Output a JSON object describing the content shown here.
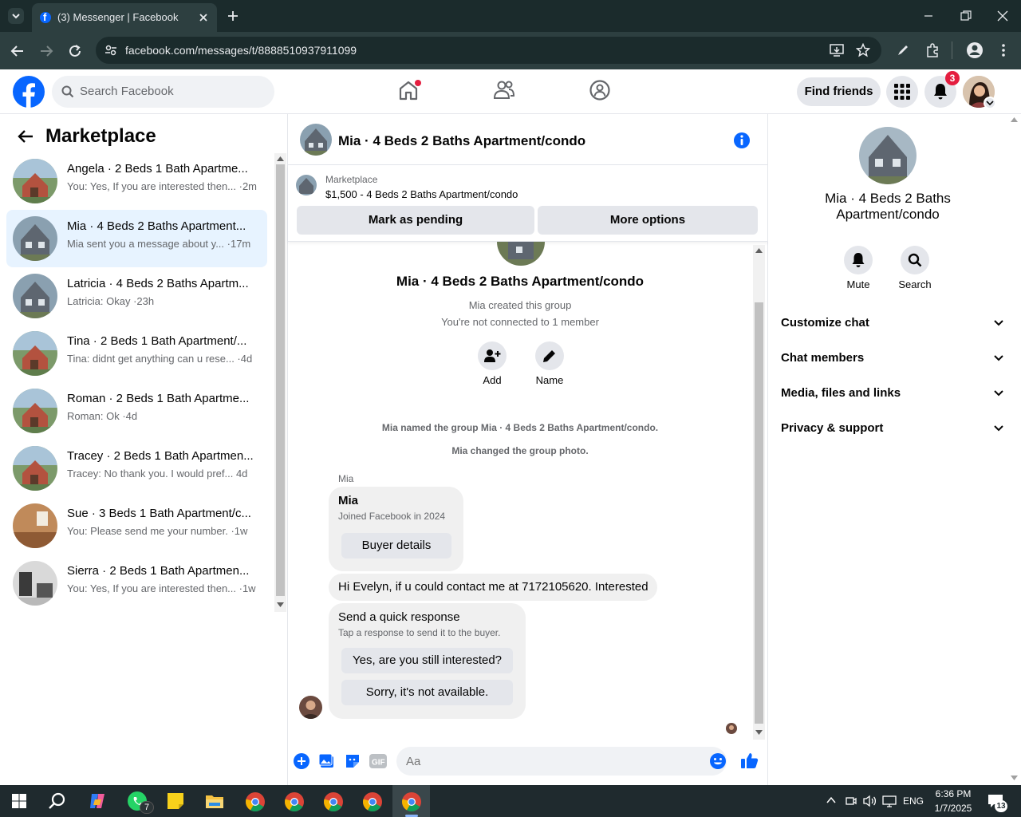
{
  "browser": {
    "tab_title": "(3) Messenger | Facebook",
    "url": "facebook.com/messages/t/8888510937911099"
  },
  "header": {
    "search_placeholder": "Search Facebook",
    "find_friends": "Find friends",
    "notification_count": "3",
    "accent": "#0866ff"
  },
  "sidebar": {
    "title": "Marketplace",
    "conversations": [
      {
        "name": "Angela · 2 Beds 1 Bath Apartme...",
        "preview": "You: Yes, If you are interested then... ·2m"
      },
      {
        "name": "Mia · 4 Beds 2 Baths Apartment...",
        "preview": "Mia sent you a message about y... ·17m"
      },
      {
        "name": "Latricia · 4 Beds 2 Baths Apartm...",
        "preview": "Latricia: Okay ·23h"
      },
      {
        "name": "Tina · 2 Beds 1 Bath Apartment/...",
        "preview": "Tina: didnt get anything can u rese... ·4d"
      },
      {
        "name": "Roman · 2 Beds 1 Bath Apartme...",
        "preview": "Roman: Ok ·4d"
      },
      {
        "name": "Tracey · 2 Beds 1 Bath Apartmen...",
        "preview": "Tracey: No thank you. I would pref... 4d"
      },
      {
        "name": "Sue · 3 Beds 1 Bath Apartment/c...",
        "preview": "You: Please send me your number. ·1w"
      },
      {
        "name": "Sierra · 2 Beds 1 Bath Apartmen...",
        "preview": "You: Yes, If you are interested then... ·1w"
      }
    ]
  },
  "chat": {
    "title": "Mia · 4 Beds 2 Baths Apartment/condo",
    "marketplace_label": "Marketplace",
    "listing": "$1,500 - 4 Beds 2 Baths Apartment/condo",
    "mark_pending": "Mark as pending",
    "more_options": "More options",
    "group_name": "Mia · 4 Beds 2 Baths Apartment/condo",
    "created_by": "Mia created this group",
    "not_connected": "You're not connected to 1 member",
    "add_label": "Add",
    "name_label": "Name",
    "sys_named": "Mia named the group Mia · 4 Beds 2 Baths Apartment/condo.",
    "sys_photo": "Mia changed the group photo.",
    "sender": "Mia",
    "card_name": "Mia",
    "card_joined": "Joined Facebook in 2024",
    "buyer_details": "Buyer details",
    "message": "Hi Evelyn, if u could contact me at 7172105620. Interested",
    "quick_title": "Send a quick response",
    "quick_sub": "Tap a response to send it to the buyer.",
    "quick_1": "Yes, are you still interested?",
    "quick_2": "Sorry, it's not available.",
    "composer_placeholder": "Aa"
  },
  "right_panel": {
    "title": "Mia · 4 Beds 2 Baths Apartment/condo",
    "mute": "Mute",
    "search": "Search",
    "sections": [
      "Customize chat",
      "Chat members",
      "Media, files and links",
      "Privacy & support"
    ]
  },
  "taskbar": {
    "whatsapp_badge": "7",
    "language": "ENG",
    "time": "6:36 PM",
    "date": "1/7/2025",
    "notifications": "13"
  }
}
